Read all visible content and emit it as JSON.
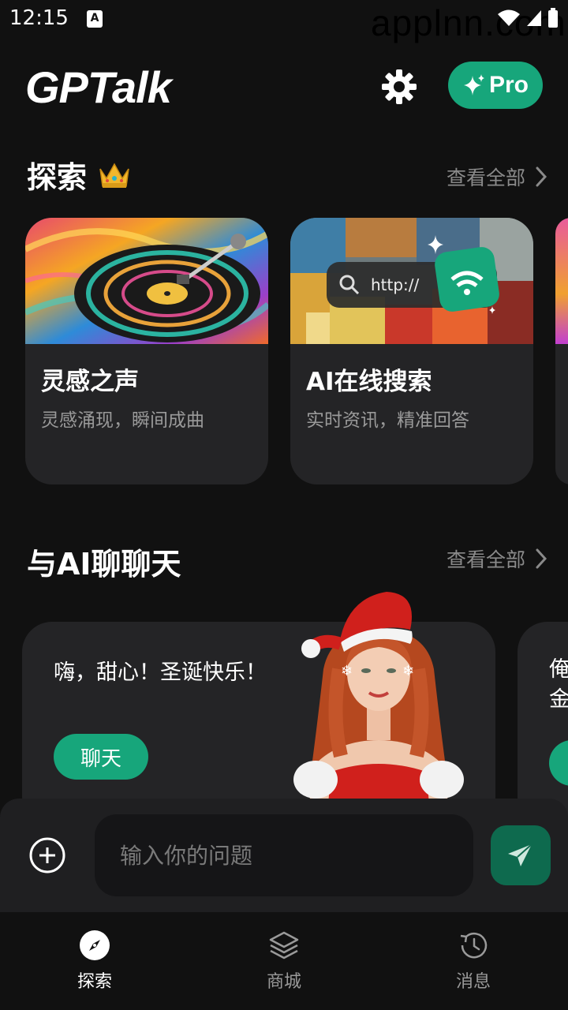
{
  "status_bar": {
    "time": "12:15",
    "notification_icon": "a-icon",
    "watermark": "applnn.com"
  },
  "header": {
    "logo": "GPTalk",
    "pro_label": "Pro"
  },
  "explore": {
    "title": "探索",
    "view_all": "查看全部",
    "cards": [
      {
        "title": "灵感之声",
        "subtitle": "灵感涌现，瞬间成曲",
        "image": "vinyl-record"
      },
      {
        "title": "AI在线搜索",
        "subtitle": "实时资讯，精准回答",
        "image": "search-bar",
        "search_text": "http://"
      }
    ]
  },
  "chat": {
    "title": "与AI聊聊天",
    "view_all": "查看全部",
    "cards": [
      {
        "greeting": "嗨，甜心！圣诞快乐！",
        "button": "聊天"
      },
      {
        "greeting": "俺金"
      }
    ]
  },
  "input": {
    "placeholder": "输入你的问题"
  },
  "nav": {
    "items": [
      {
        "label": "探索",
        "icon": "compass-icon",
        "active": true
      },
      {
        "label": "商城",
        "icon": "layers-icon",
        "active": false
      },
      {
        "label": "消息",
        "icon": "history-icon",
        "active": false
      }
    ]
  },
  "colors": {
    "accent": "#17a67b",
    "background": "#111111",
    "card": "#242426"
  }
}
